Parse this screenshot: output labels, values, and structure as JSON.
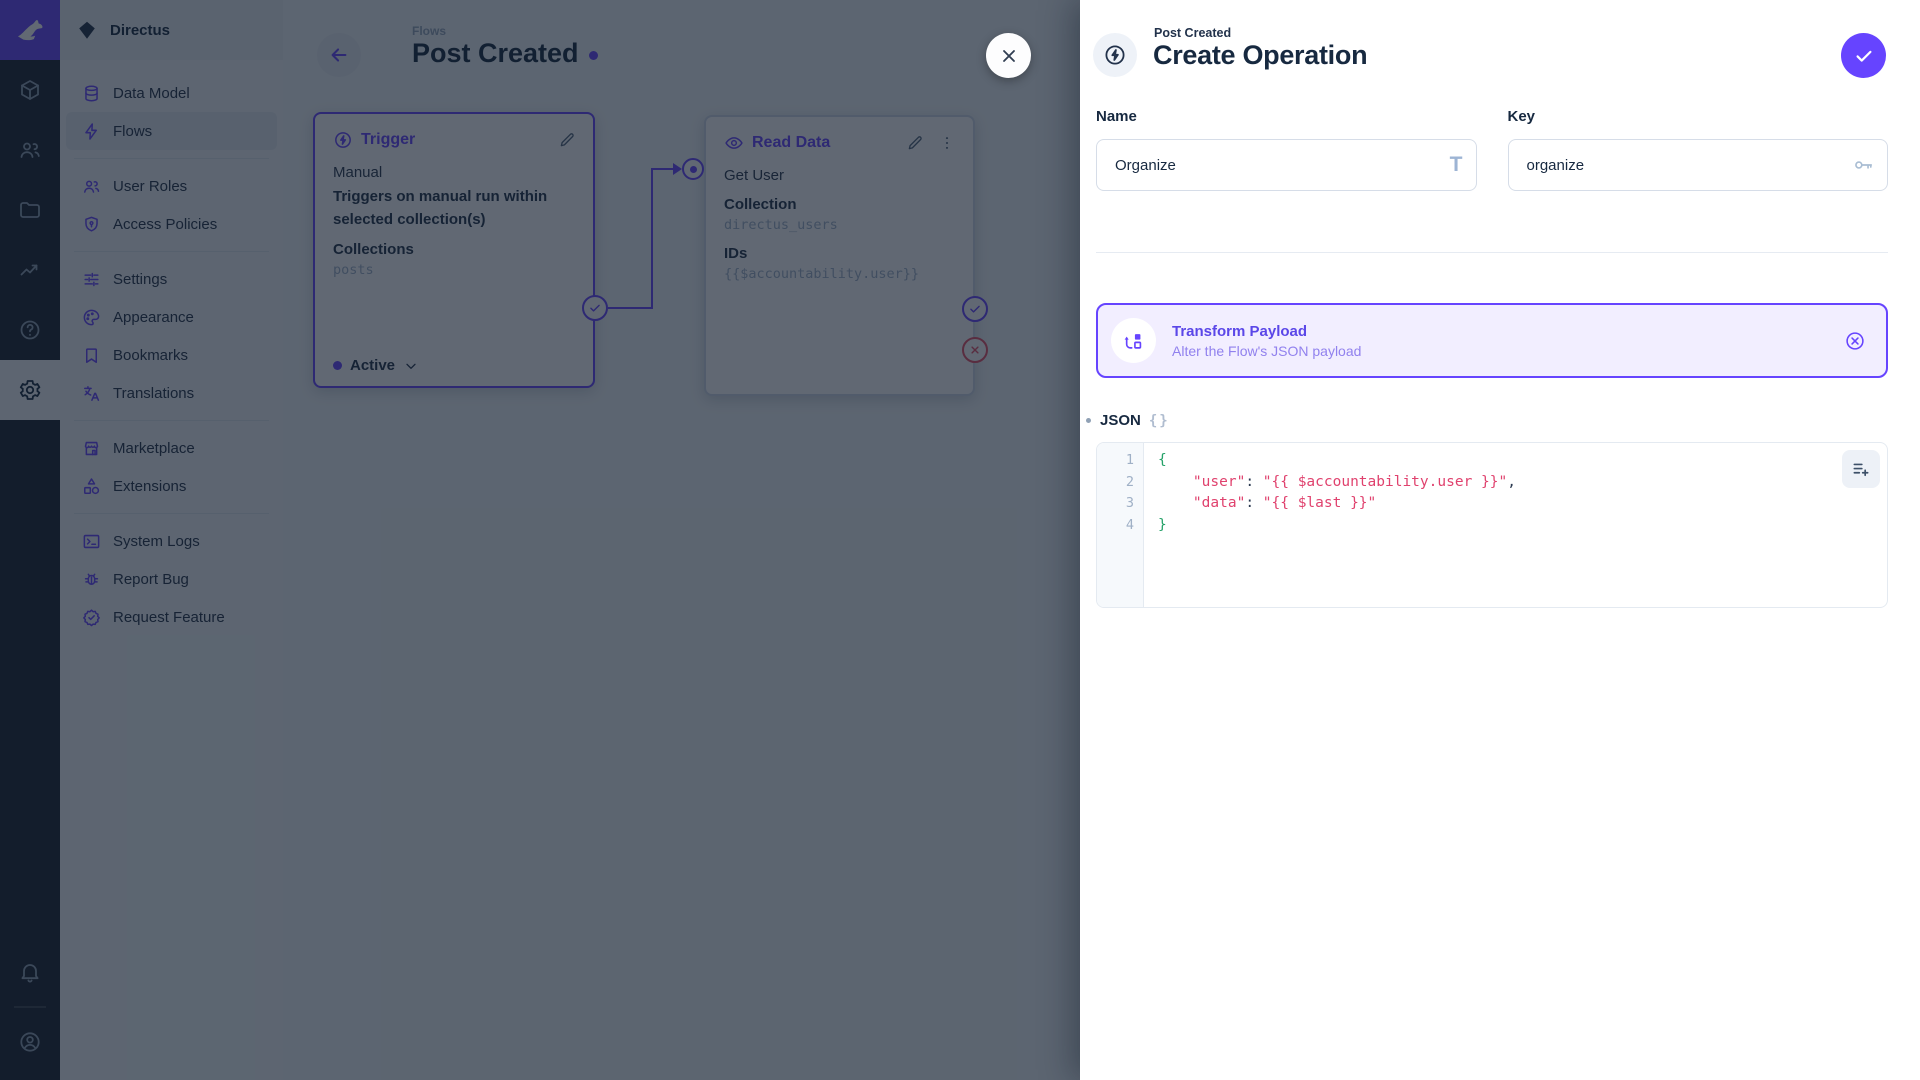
{
  "colors": {
    "primary": "#6644ff",
    "danger": "#e35169",
    "code_string": "#e0426e",
    "code_brace": "#26a269",
    "module_bar_bg": "#18222f",
    "sidebar_bg": "#f0f4f9"
  },
  "sidebar": {
    "project_name": "Directus",
    "items": [
      {
        "label": "Data Model"
      },
      {
        "label": "Flows"
      },
      {
        "label": "User Roles"
      },
      {
        "label": "Access Policies"
      },
      {
        "label": "Settings"
      },
      {
        "label": "Appearance"
      },
      {
        "label": "Bookmarks"
      },
      {
        "label": "Translations"
      },
      {
        "label": "Marketplace"
      },
      {
        "label": "Extensions"
      },
      {
        "label": "System Logs"
      },
      {
        "label": "Report Bug"
      },
      {
        "label": "Request Feature"
      }
    ]
  },
  "canvas": {
    "breadcrumb": "Flows",
    "title": "Post Created",
    "trigger": {
      "title": "Trigger",
      "type": "Manual",
      "description": "Triggers on manual run within selected collection(s)",
      "collections_label": "Collections",
      "collections_value": "posts",
      "status_label": "Active"
    },
    "read": {
      "title": "Read Data",
      "name": "Get User",
      "collection_label": "Collection",
      "collection_value": "directus_users",
      "ids_label": "IDs",
      "ids_value": "{{$accountability.user}}"
    }
  },
  "drawer": {
    "breadcrumb": "Post Created",
    "title": "Create Operation",
    "fields": {
      "name_label": "Name",
      "name_value": "Organize",
      "key_label": "Key",
      "key_value": "organize"
    },
    "operation": {
      "title": "Transform Payload",
      "subtitle": "Alter the Flow's JSON payload"
    },
    "json": {
      "label": "JSON",
      "braces": "{}",
      "line_numbers": [
        "1",
        "2",
        "3",
        "4"
      ],
      "lines": [
        [
          "{"
        ],
        [
          "    ",
          "\"user\"",
          ": ",
          "\"{{ $accountability.user }}\"",
          ","
        ],
        [
          "    ",
          "\"data\"",
          ": ",
          "\"{{ $last }}\""
        ],
        [
          "}"
        ]
      ]
    }
  }
}
